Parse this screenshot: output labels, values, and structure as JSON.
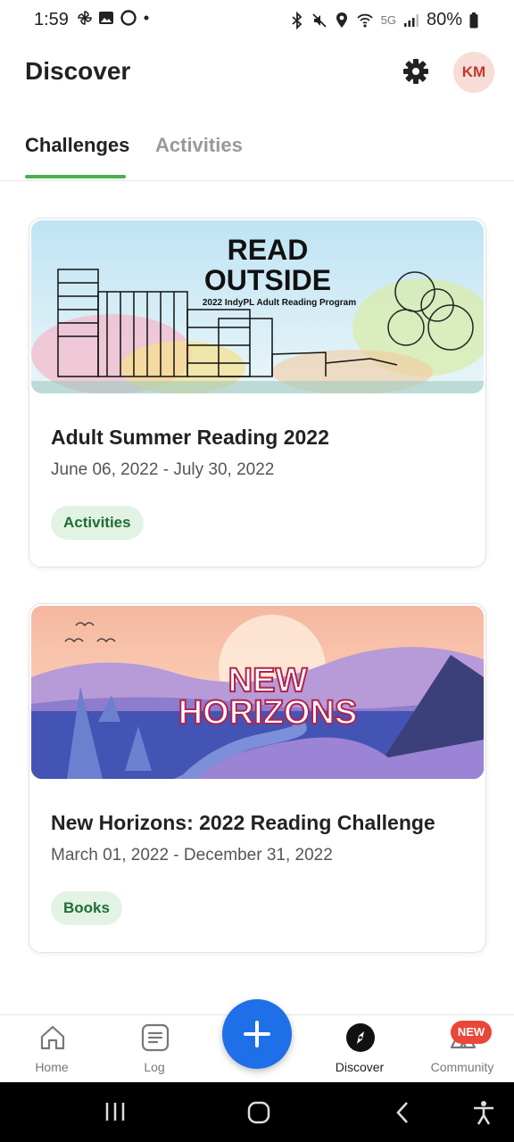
{
  "status_bar": {
    "time": "1:59",
    "network": "5G",
    "battery": "80%"
  },
  "header": {
    "title": "Discover",
    "avatar_initials": "KM",
    "settings_icon": "gear-icon"
  },
  "tabs": [
    {
      "label": "Challenges",
      "selected": true
    },
    {
      "label": "Activities",
      "selected": false
    }
  ],
  "challenges": [
    {
      "banner_title_line1": "READ",
      "banner_title_line2": "OUTSIDE",
      "banner_subtitle": "2022 IndyPL Adult Reading Program",
      "title": "Adult Summer Reading 2022",
      "dates": "June 06, 2022 - July 30, 2022",
      "tag": "Activities"
    },
    {
      "banner_title_line1": "NEW",
      "banner_title_line2": "HORIZONS",
      "title": "New Horizons: 2022 Reading Challenge",
      "dates": "March 01, 2022 - December 31, 2022",
      "tag": "Books"
    }
  ],
  "bottom_nav": {
    "home": "Home",
    "log": "Log",
    "discover": "Discover",
    "community": "Community",
    "community_badge": "NEW",
    "active": "discover"
  },
  "colors": {
    "accent_green": "#4caf50",
    "fab_blue": "#1e6fe8",
    "badge_red": "#e8473a"
  }
}
